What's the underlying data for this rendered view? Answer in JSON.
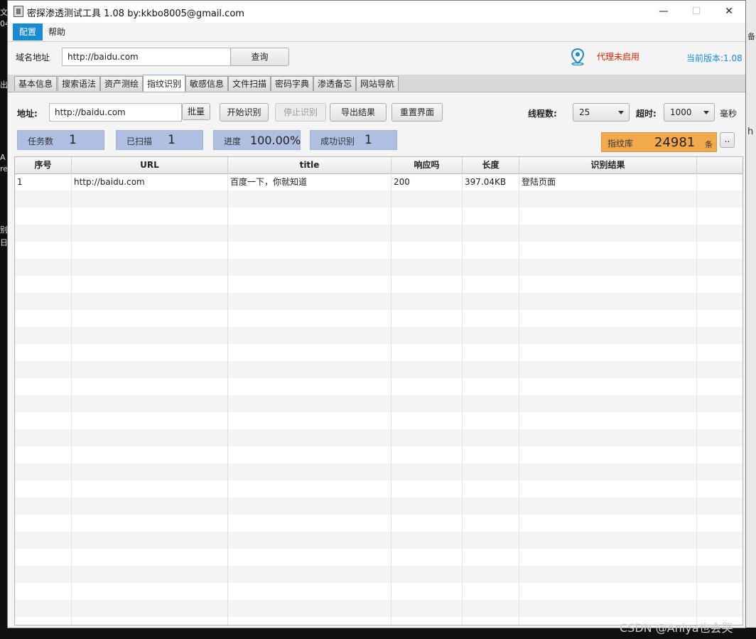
{
  "window": {
    "title": "密探渗透测试工具 1.08 by:kkbo8005@gmail.com",
    "controls": {
      "minimize": "—",
      "maximize": "☐",
      "close": "✕"
    }
  },
  "menu": [
    {
      "label": "配置",
      "active": true
    },
    {
      "label": "帮助",
      "active": false
    }
  ],
  "header": {
    "domain_label": "域名地址",
    "domain_value": "http://baidu.com",
    "query_button": "查询",
    "proxy_status": "代理未启用",
    "version": "当前版本:1.08",
    "colors": {
      "proxy": "#d81e06",
      "version": "#1a8ad3",
      "location_icon": "#1a8ad3"
    }
  },
  "tabs": [
    {
      "label": "基本信息",
      "active": false
    },
    {
      "label": "搜索语法",
      "active": false
    },
    {
      "label": "资产测绘",
      "active": false
    },
    {
      "label": "指纹识别",
      "active": true
    },
    {
      "label": "敏感信息",
      "active": false
    },
    {
      "label": "文件扫描",
      "active": false
    },
    {
      "label": "密码字典",
      "active": false
    },
    {
      "label": "渗透备忘",
      "active": false
    },
    {
      "label": "网站导航",
      "active": false
    }
  ],
  "toolbar": {
    "address_label": "地址:",
    "address_value": "http://baidu.com",
    "batch": "批量",
    "start": "开始识别",
    "stop": "停止识别",
    "export": "导出结果",
    "reset": "重置界面",
    "threads_label": "线程数:",
    "threads_value": "25",
    "timeout_label": "超时:",
    "timeout_value": "1000",
    "ms_label": "毫秒"
  },
  "stats": {
    "tasks_label": "任务数",
    "tasks": "1",
    "scanned_label": "已扫描",
    "scanned": "1",
    "progress_label": "进度",
    "progress": "100.00%",
    "success_label": "成功识别",
    "success": "1",
    "library_label": "指纹库",
    "library_count": "24981",
    "library_unit": "条",
    "more_button": ".."
  },
  "table": {
    "columns": [
      "序号",
      "URL",
      "title",
      "响应吗",
      "长度",
      "识别结果",
      ""
    ],
    "rows": [
      [
        "1",
        "http://baidu.com",
        "百度一下，你就知道",
        "200",
        "397.04KB",
        "登陆页面",
        ""
      ]
    ],
    "total_rows": 27
  },
  "watermark": "CSDN @Aniya也会哭",
  "desktop_fragments": [
    "文",
    "04",
    "出",
    "A",
    "re",
    "别",
    "日",
    "备",
    "h"
  ]
}
